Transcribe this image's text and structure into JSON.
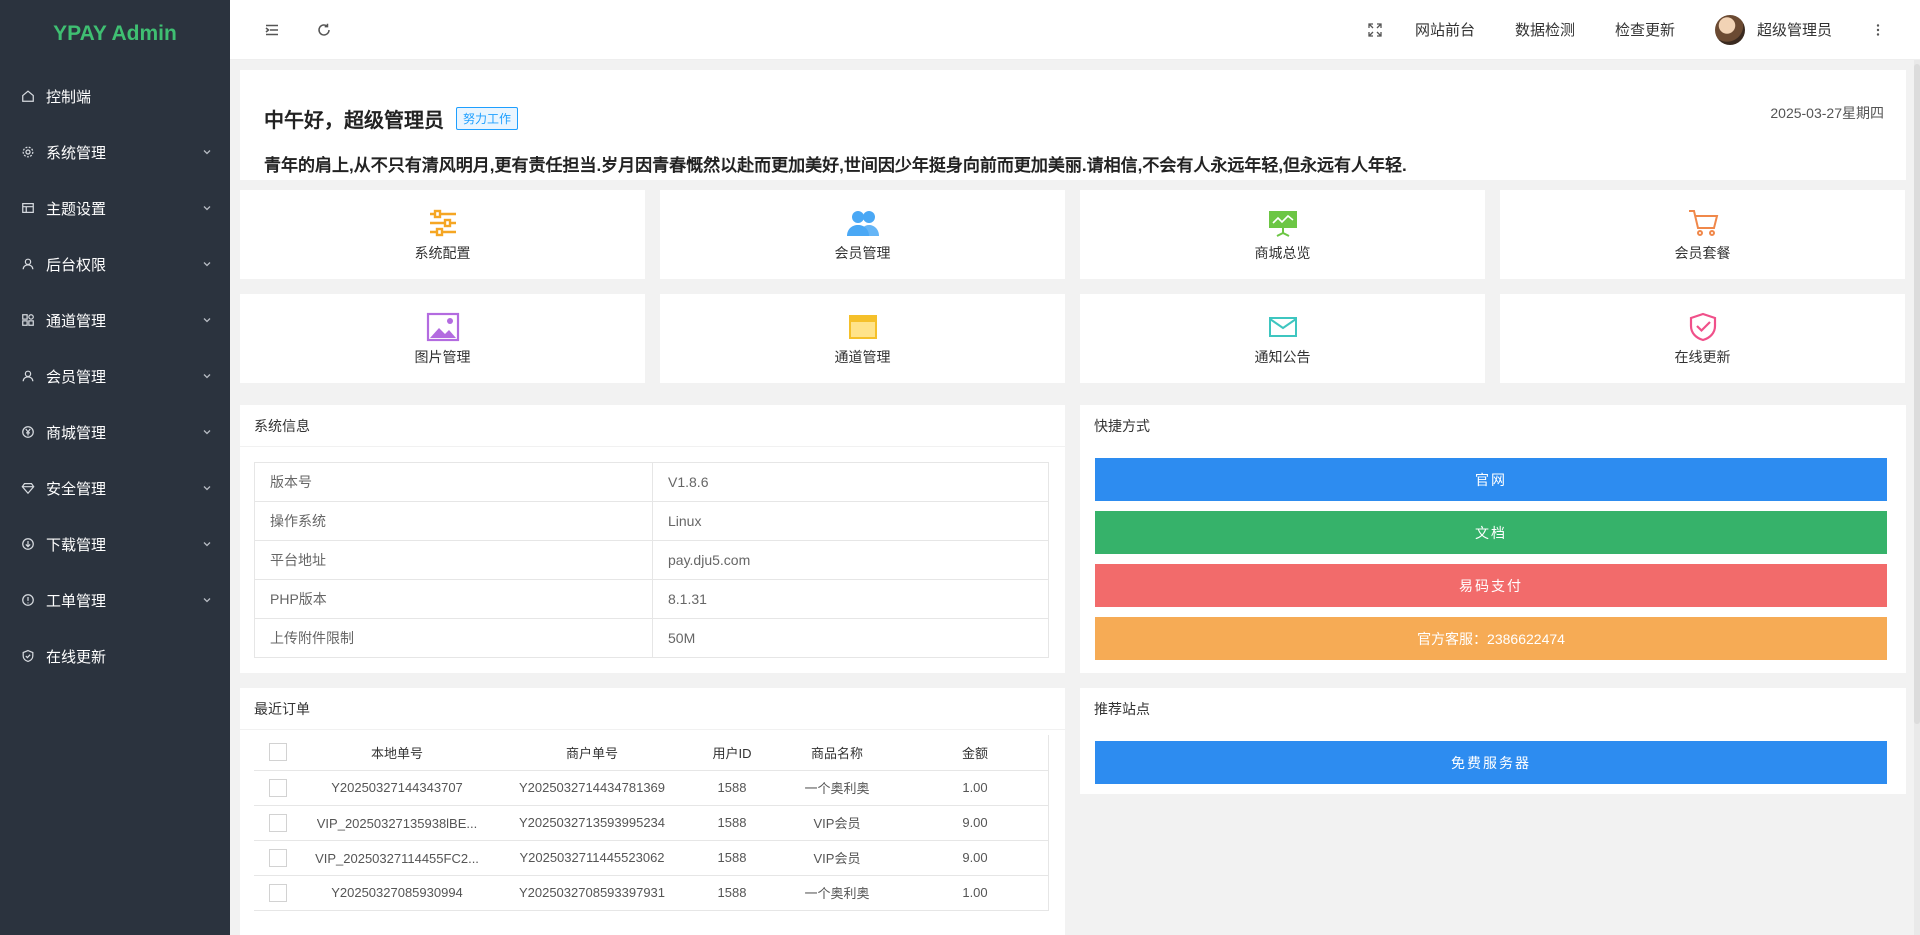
{
  "sidebar": {
    "logo": "YPAY Admin",
    "items": [
      {
        "label": "控制端",
        "icon": "home-icon",
        "has_submenu": false
      },
      {
        "label": "系统管理",
        "icon": "gear-icon",
        "has_submenu": true
      },
      {
        "label": "主题设置",
        "icon": "layout-icon",
        "has_submenu": true
      },
      {
        "label": "后台权限",
        "icon": "user-icon",
        "has_submenu": true
      },
      {
        "label": "通道管理",
        "icon": "apps-icon",
        "has_submenu": true
      },
      {
        "label": "会员管理",
        "icon": "user-icon",
        "has_submenu": true
      },
      {
        "label": "商城管理",
        "icon": "yen-icon",
        "has_submenu": true
      },
      {
        "label": "安全管理",
        "icon": "diamond-icon",
        "has_submenu": true
      },
      {
        "label": "下载管理",
        "icon": "download-icon",
        "has_submenu": true
      },
      {
        "label": "工单管理",
        "icon": "info-icon",
        "has_submenu": true
      },
      {
        "label": "在线更新",
        "icon": "shield-check-icon",
        "has_submenu": false
      }
    ]
  },
  "header": {
    "links": [
      "网站前台",
      "数据检测",
      "检查更新"
    ],
    "user_name": "超级管理员"
  },
  "welcome": {
    "greeting": "中午好，超级管理员",
    "tag": "努力工作",
    "date": "2025-03-27星期四",
    "motto": "青年的肩上,从不只有清风明月,更有责任担当.岁月因青春慨然以赴而更加美好,世间因少年挺身向前而更加美丽.请相信,不会有人永远年轻,但永远有人年轻."
  },
  "quick_cards": [
    {
      "label": "系统配置",
      "icon": "sliders-icon",
      "color": "#f5a623"
    },
    {
      "label": "会员管理",
      "icon": "users-icon",
      "color": "#4aa8f5"
    },
    {
      "label": "商城总览",
      "icon": "presentation-icon",
      "color": "#6cc644"
    },
    {
      "label": "会员套餐",
      "icon": "cart-icon",
      "color": "#f0884a"
    },
    {
      "label": "图片管理",
      "icon": "image-icon",
      "color": "#b36be0"
    },
    {
      "label": "通道管理",
      "icon": "window-icon",
      "color": "#f5c02a"
    },
    {
      "label": "通知公告",
      "icon": "mail-icon",
      "color": "#3ec6c0"
    },
    {
      "label": "在线更新",
      "icon": "shield-check-icon",
      "color": "#f0508a"
    }
  ],
  "system_info": {
    "title": "系统信息",
    "rows": [
      {
        "key": "版本号",
        "value": "V1.8.6"
      },
      {
        "key": "操作系统",
        "value": "Linux"
      },
      {
        "key": "平台地址",
        "value": "pay.dju5.com"
      },
      {
        "key": "PHP版本",
        "value": "8.1.31"
      },
      {
        "key": "上传附件限制",
        "value": "50M"
      }
    ]
  },
  "shortcuts": {
    "title": "快捷方式",
    "buttons": [
      {
        "label": "官网",
        "color": "#2d8cf0"
      },
      {
        "label": "文档",
        "color": "#36b26a"
      },
      {
        "label": "易码支付",
        "color": "#f26b6b"
      },
      {
        "label": "官方客服：2386622474",
        "color": "#f6ab55"
      }
    ]
  },
  "recent_orders": {
    "title": "最近订单",
    "columns": [
      "本地单号",
      "商户单号",
      "用户ID",
      "商品名称",
      "金额"
    ],
    "rows": [
      [
        "Y20250327144343707",
        "Y2025032714434781369",
        "1588",
        "一个奥利奥",
        "1.00"
      ],
      [
        "VIP_20250327135938lBE...",
        "Y2025032713593995234",
        "1588",
        "VIP会员",
        "9.00"
      ],
      [
        "VIP_20250327114455FC2...",
        "Y2025032711445523062",
        "1588",
        "VIP会员",
        "9.00"
      ],
      [
        "Y20250327085930994",
        "Y2025032708593397931",
        "1588",
        "一个奥利奥",
        "1.00"
      ]
    ]
  },
  "recommended": {
    "title": "推荐站点",
    "buttons": [
      {
        "label": "免费服务器",
        "color": "#2d8cf0"
      }
    ]
  }
}
